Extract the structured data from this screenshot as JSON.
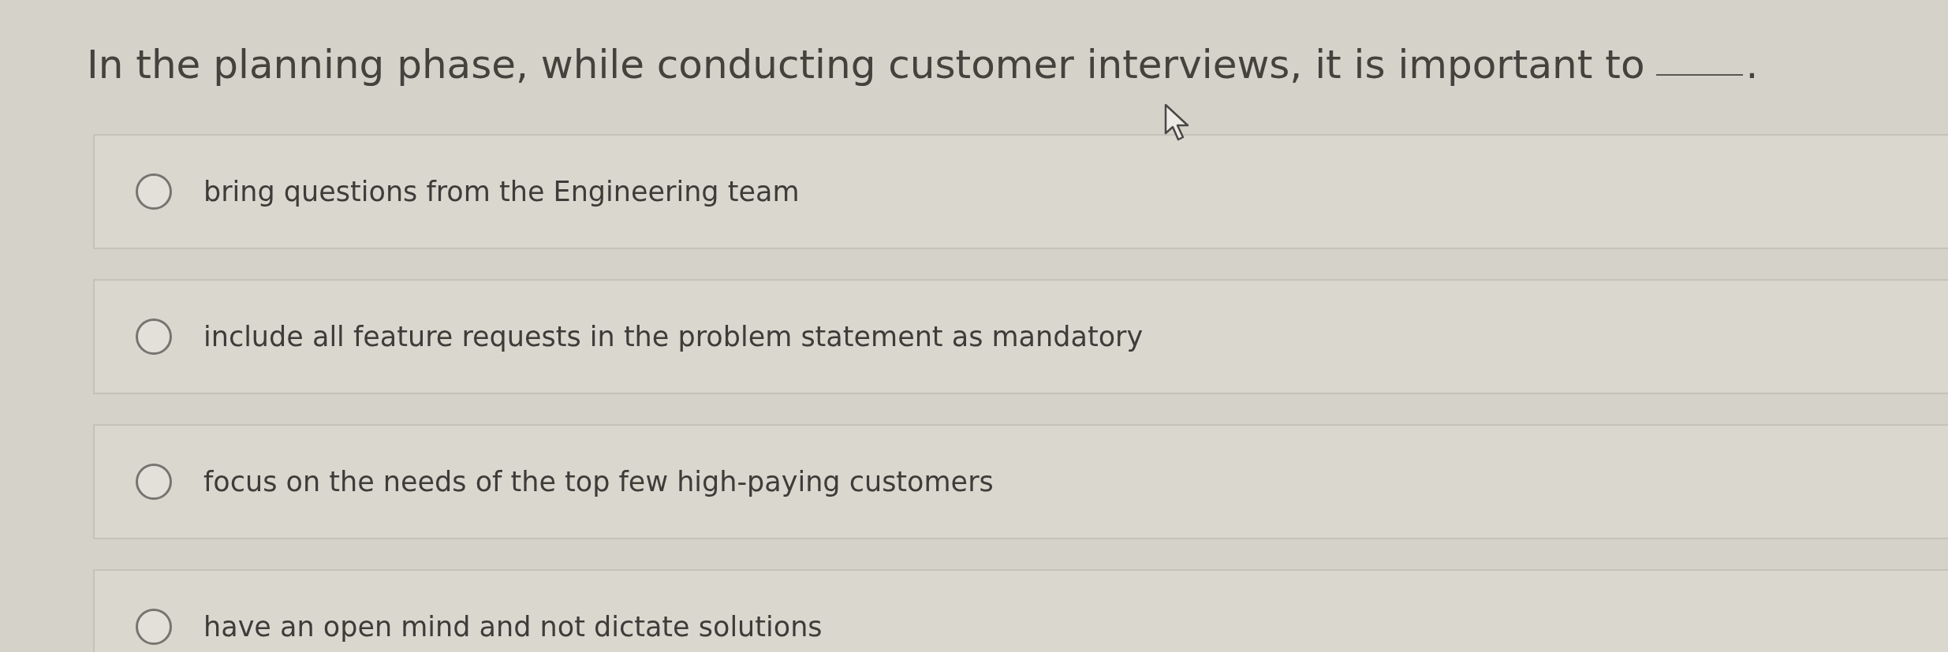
{
  "question": {
    "text": "In the planning phase, while conducting customer interviews, it is important to",
    "after_blank": "."
  },
  "options": [
    {
      "label": "bring questions from the Engineering team",
      "selected": false
    },
    {
      "label": "include all feature requests in the problem statement as mandatory",
      "selected": false
    },
    {
      "label": "focus on the needs of the top few high-paying customers",
      "selected": false
    },
    {
      "label": "have an open mind and not dictate solutions",
      "selected": false
    }
  ]
}
